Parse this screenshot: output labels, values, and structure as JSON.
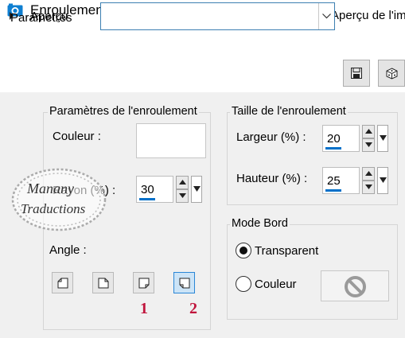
{
  "window": {
    "title": "Enroulement de page",
    "icon": "camera-icon"
  },
  "preview": {
    "label": "Aperçu",
    "checkbox_label": "Aperçu de l'im",
    "checked": true
  },
  "presets": {
    "label": "Paramètres",
    "value": "",
    "save_icon": "save-icon",
    "random_icon": "dice-icon"
  },
  "curl_settings": {
    "title": "Paramètres de l'enroulement",
    "color_label": "Couleur :",
    "color_value": "#ffffff",
    "radius_label": "Rayon (%) :",
    "radius_value": "30",
    "angle_label": "Angle :",
    "angle_options": [
      "top-left",
      "top-right",
      "bottom-right",
      "bottom-left"
    ],
    "angle_selected": "bottom-left"
  },
  "curl_size": {
    "title": "Taille de l'enroulement",
    "width_label": "Largeur (%) :",
    "width_value": "20",
    "height_label": "Hauteur (%) :",
    "height_value": "25"
  },
  "edge_mode": {
    "title": "Mode Bord",
    "options": [
      "Transparent",
      "Couleur"
    ],
    "selected": "Transparent",
    "color_icon": "no-color-icon"
  },
  "annotations": {
    "marker_1": "1",
    "marker_2": "2"
  },
  "watermark": {
    "line1": "Manany",
    "line2": "Traductions"
  },
  "colors": {
    "accent": "#0070c9",
    "marker": "#c0143c",
    "selected_button": "#cce4f7"
  }
}
